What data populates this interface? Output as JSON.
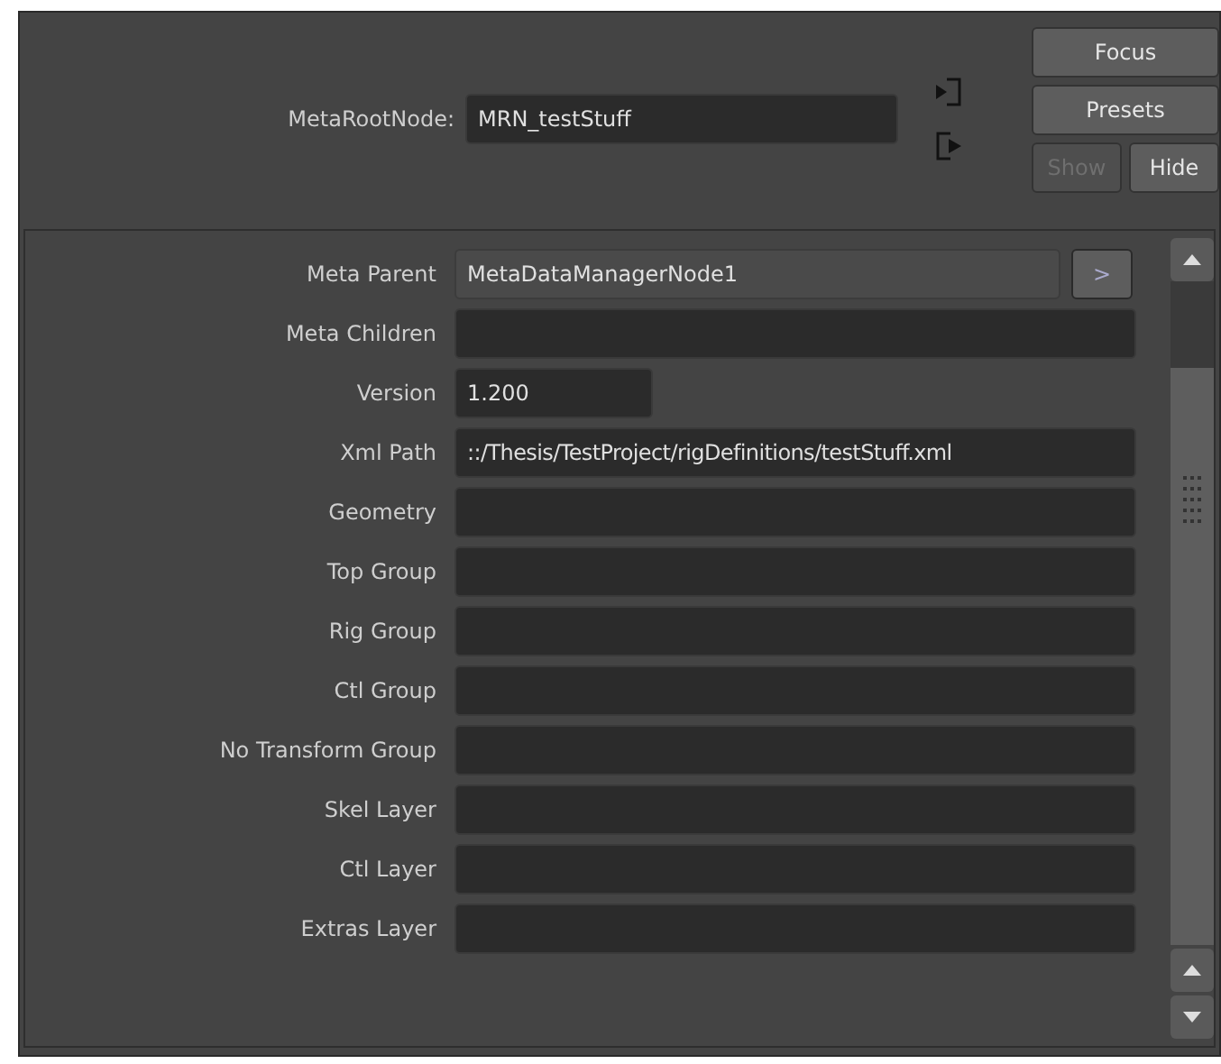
{
  "root": {
    "label": "MetaRootNode:",
    "value": "MRN_testStuff"
  },
  "buttons": [
    {
      "label": "Focus",
      "disabled": false
    },
    {
      "label": "Presets",
      "disabled": false
    }
  ],
  "show_hide": [
    {
      "label": "Show",
      "disabled": true
    },
    {
      "label": "Hide",
      "disabled": false
    }
  ],
  "attributes": [
    {
      "label": "Meta Parent",
      "value": "MetaDataManagerNode1",
      "kind": "readonly",
      "button": ">"
    },
    {
      "label": "Meta Children",
      "kind": "text"
    },
    {
      "label": "Version",
      "value": "1.200",
      "kind": "short"
    },
    {
      "label": "Xml Path",
      "value": "::/Thesis/TestProject/rigDefinitions/testStuff.xml",
      "kind": "text"
    },
    {
      "label": "Geometry",
      "kind": "text"
    },
    {
      "label": "Top Group",
      "kind": "text"
    },
    {
      "label": "Rig Group",
      "kind": "text"
    },
    {
      "label": "Ctl Group",
      "kind": "text"
    },
    {
      "label": "No Transform Group",
      "kind": "text"
    },
    {
      "label": "Skel Layer",
      "kind": "text"
    },
    {
      "label": "Ctl Layer",
      "kind": "text"
    },
    {
      "label": "Extras Layer",
      "kind": "text"
    }
  ]
}
